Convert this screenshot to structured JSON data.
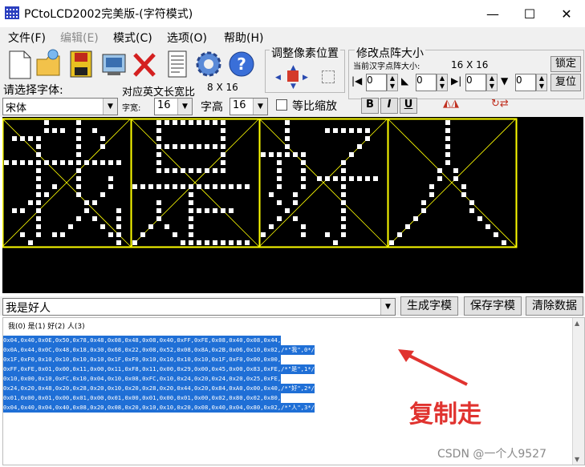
{
  "window": {
    "title": "PCtoLCD2002完美版-(字符模式)",
    "minimize": "—",
    "maximize": "☐",
    "close": "✕"
  },
  "menu": [
    "文件(F)",
    "编辑(E)",
    "模式(C)",
    "选项(O)",
    "帮助(H)"
  ],
  "toolbar": {
    "icons": [
      "new-file-icon",
      "open-folder-icon",
      "save-icon",
      "save-as-icon",
      "delete-icon",
      "document-icon",
      "settings-gear-icon",
      "help-icon"
    ],
    "pixel_group_label": "调整像素位置",
    "matrix_group_label": "修改点阵大小",
    "current_char_size_label": "当前汉字点阵大小:",
    "current_char_size_value": "16 X 16",
    "lock_label": "锁定",
    "restore_label": "复位",
    "spin_values": [
      "0",
      "0",
      "0",
      "0"
    ]
  },
  "font_row": {
    "choose_font_label": "请选择字体:",
    "font_value": "宋体",
    "ratio_label": "对应英文长宽比",
    "ratio_value": "8 X 16",
    "width_label": "字宽:",
    "width_value": "16",
    "height_label": "字高",
    "height_value": "16",
    "proportional_label": "等比缩放",
    "bold": "B",
    "italic": "I",
    "underline": "U"
  },
  "input": {
    "text": "我是好人",
    "generate_button": "生成字模",
    "save_button": "保存字模",
    "clear_button": "清除数据"
  },
  "output": {
    "index_line": "我(0) 是(1) 好(2) 人(3)",
    "hex_lines": [
      "0x04,0x40,0x0E,0x50,0x78,0x48,0x08,0x48,0x08,0x40,0xFF,0xFE,0x08,0x40,0x08,0x44,",
      "0x0A,0x44,0x0C,0x48,0x18,0x30,0x68,0x22,0x08,0x52,0x08,0x8A,0x2B,0x06,0x10,0x02,/*\"我\",0*/",
      "0x1F,0xF0,0x10,0x10,0x10,0x10,0x1F,0xF0,0x10,0x10,0x10,0x10,0x1F,0xF0,0x00,0x00,",
      "0xFF,0xFE,0x01,0x00,0x11,0x00,0x11,0xF8,0x11,0x00,0x29,0x00,0x45,0x00,0x83,0xFE,/*\"是\",1*/",
      "0x10,0x00,0x10,0xFC,0x10,0x04,0x10,0x08,0xFC,0x10,0x24,0x20,0x24,0x20,0x25,0xFE,",
      "0x24,0x20,0x48,0x20,0x28,0x20,0x10,0x20,0x28,0x20,0x44,0x20,0x84,0xA0,0x00,0x40,/*\"好\",2*/",
      "0x01,0x00,0x01,0x00,0x01,0x00,0x01,0x00,0x01,0x00,0x01,0x00,0x02,0x80,0x02,0x80,",
      "0x04,0x40,0x04,0x40,0x08,0x20,0x08,0x20,0x10,0x10,0x20,0x08,0x40,0x04,0x80,0x02,/*\"人\",3*/"
    ]
  },
  "annotation": "复制走",
  "watermark": "CSDN @一个人9527",
  "glyphs": [
    [
      "0000010001000000",
      "0000011101010000",
      "0111100001001000",
      "0000100001001000",
      "0000100001000000",
      "1111111111111110",
      "0000100001000000",
      "0000100001000100",
      "0000101001000100",
      "0000110001001000",
      "0001100000110000",
      "0110100000100010",
      "0000100001010010",
      "0000100010001010",
      "0010101100000110",
      "0001000000000010"
    ],
    [
      "0001111111110000",
      "0001000000010000",
      "0001000000010000",
      "0001111111110000",
      "0001000000010000",
      "0001000000010000",
      "0001111111110000",
      "0000000000000000",
      "1111111111111110",
      "0000000100000000",
      "0001000100000000",
      "0001000111111000",
      "0001000100000000",
      "0010100100000000",
      "0100010100000000",
      "1000001111111110"
    ],
    [
      "0001000000000000",
      "0001000011111100",
      "0001000000000100",
      "0001000000001000",
      "1111110000010000",
      "0010010000100000",
      "0010010000100000",
      "0010010111111110",
      "0010010000100000",
      "0100100000100000",
      "0010100000100000",
      "0001000000100000",
      "0010100000100000",
      "0100010000100000",
      "1000010010100000",
      "0000000001000000"
    ],
    [
      "0000000100000000",
      "0000000100000000",
      "0000000100000000",
      "0000000100000000",
      "0000000100000000",
      "0000000100000000",
      "0000001010000000",
      "0000001010000000",
      "0000010001000000",
      "0000010001000000",
      "0000100000100000",
      "0000100000100000",
      "0001000000010000",
      "0010000000001000",
      "0100000000000100",
      "1000000000000010"
    ]
  ],
  "colors": {
    "grid": "#ffff00",
    "pixel": "#ffffff",
    "selection": "#1f6fd6",
    "annotation": "#e0332f"
  }
}
